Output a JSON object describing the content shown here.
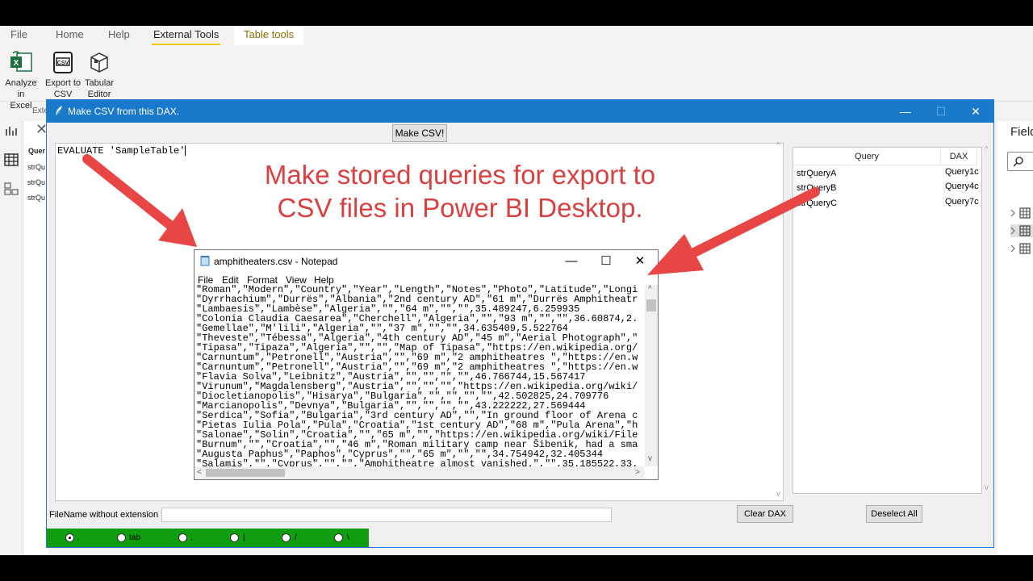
{
  "ribbon": {
    "tabs": [
      "File",
      "Home",
      "Help",
      "External Tools",
      "Table tools"
    ],
    "active_tab": "External Tools",
    "buttons": [
      {
        "label_line1": "Analyze in",
        "label_line2": "Excel",
        "icon": "excel-icon"
      },
      {
        "label_line1": "Export to",
        "label_line2": "CSV",
        "icon": "csv-icon"
      },
      {
        "label_line1": "Tabular",
        "label_line2": "Editor",
        "icon": "tabular-editor-icon"
      }
    ],
    "group_label": "Exte"
  },
  "side_pane": {
    "header": "Quer",
    "items": [
      "strQu",
      "strQu",
      "strQu"
    ]
  },
  "fields_pane": {
    "title": "Field"
  },
  "dialog": {
    "title": "Make CSV from this DAX.",
    "minimize": "—",
    "maximize": "☐",
    "close": "✕",
    "make_button": "Make CSV!",
    "editor_text": "EVALUATE 'SampleTable'",
    "query_list": {
      "headers": [
        "Query",
        "DAX"
      ],
      "rows": [
        {
          "query": "strQueryA",
          "dax": "Query1c"
        },
        {
          "query": "strQueryB",
          "dax": "Query4c"
        },
        {
          "query": "strQueryC",
          "dax": "Query7c"
        }
      ]
    },
    "filename_label": "FileName without extension",
    "filename_value": "",
    "clear_button": "Clear DAX",
    "deselect_button": "Deselect All",
    "delimiters": [
      {
        "label": ",",
        "checked": true
      },
      {
        "label": "tab",
        "checked": false
      },
      {
        "label": ";",
        "checked": false
      },
      {
        "label": "|",
        "checked": false
      },
      {
        "label": "/",
        "checked": false
      },
      {
        "label": "\\",
        "checked": false
      }
    ]
  },
  "headline": {
    "line1": "Make stored queries for export to",
    "line2": "CSV files in Power BI Desktop.",
    "color": "#d94040"
  },
  "notepad": {
    "title": "amphitheaters.csv - Notepad",
    "menu": [
      "File",
      "Edit",
      "Format",
      "View",
      "Help"
    ],
    "lines": [
      "\"Roman\",\"Modern\",\"Country\",\"Year\",\"Length\",\"Notes\",\"Photo\",\"Latitude\",\"Longi",
      "\"Dyrrhachium\",\"Durrës\",\"Albania\",\"2nd century AD\",\"61 m\",\"Durrës Amphitheatr",
      "\"Lambaesis\",\"Lambèse\",\"Algeria\",\"\",\"64 m\",\"\",\"\",35.489247,6.259935",
      "\"Colonia Claudia Caesarea\",\"Cherchell\",\"Algeria\",\"\",\"93 m\",\"\",\"\",36.60874,2.",
      "\"Gemellae\",\"M'lili\",\"Algeria\",\"\",\"37 m\",\"\",\"\",34.635409,5.522764",
      "\"Theveste\",\"Tébessa\",\"Algeria\",\"4th century AD\",\"45 m\",\"Aerial Photograph\",\"",
      "\"Tipasa\",\"Tipaza\",\"Algeria\",\"\",\"\",\"Map of Tipasa\",\"https://en.wikipedia.org/",
      "\"Carnuntum\",\"Petronell\",\"Austria\",\"\",\"69 m\",\"2 amphitheatres \",\"https://en.w",
      "\"Carnuntum\",\"Petronell\",\"Austria\",\"\",\"69 m\",\"2 amphitheatres \",\"https://en.w",
      "\"Flavia Solva\",\"Leibnitz\",\"Austria\",\"\",\"\",\"\",\"\",46.766744,15.567417",
      "\"Virunum\",\"Magdalensberg\",\"Austria\",\"\",\"\",\"\",\"https://en.wikipedia.org/wiki/",
      "\"Diocletianopolis\",\"Hisarya\",\"Bulgaria\",\"\",\"\",\"\",\"\",42.502825,24.709776",
      "\"Marcianopolis\",\"Devnya\",\"Bulgaria\",\"\",\"\",\"\",\"\",43.222222,27.569444",
      "\"Serdica\",\"Sofia\",\"Bulgaria\",\"3rd century AD\",\"\",\"In ground floor of Arena c",
      "\"Pietas Iulia Pola\",\"Pula\",\"Croatia\",\"1st century AD\",\"68 m\",\"Pula Arena\",\"h",
      "\"Salonae\",\"Solin\",\"Croatia\",\"\",\"65 m\",\"\",\"https://en.wikipedia.org/wiki/File",
      "\"Burnum\",\"\",\"Croatia\",\"\",\"46 m\",\"Roman military camp near Šibenik, had a sma",
      "\"Augusta Paphus\",\"Paphos\",\"Cyprus\",\"\",\"65 m\",\"\",\"\",34.754942,32.405344",
      "\"Salamis\",\"\",\"Cyprus\",\"\",\"\",\"Amphitheatre almost vanished.\",\"\",35.185522,33."
    ]
  }
}
